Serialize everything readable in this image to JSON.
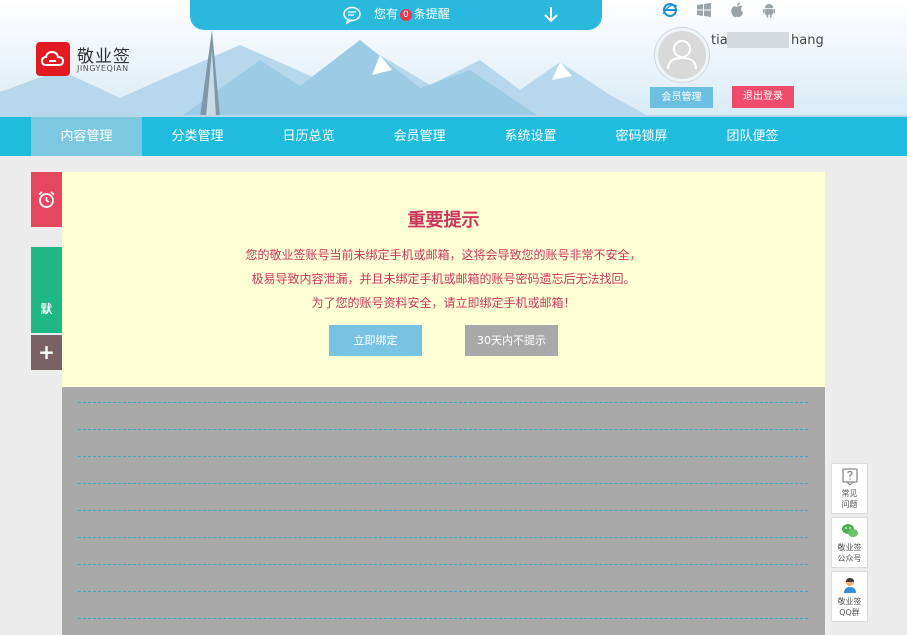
{
  "header": {
    "notice": {
      "prefix": "您有",
      "count": "0",
      "suffix": "条提醒"
    },
    "brand": {
      "name": "敬业签",
      "sub": "JINGYEQIAN"
    },
    "user": {
      "name_start": "tia",
      "name_end": "hang"
    },
    "member_button": "会员管理",
    "logout_button": "退出登录",
    "platforms": [
      "ie-icon",
      "windows-icon",
      "apple-icon",
      "android-icon"
    ]
  },
  "nav": {
    "items": [
      {
        "label": "内容管理",
        "active": true
      },
      {
        "label": "分类管理"
      },
      {
        "label": "日历总览"
      },
      {
        "label": "会员管理"
      },
      {
        "label": "系统设置"
      },
      {
        "label": "密码锁屏"
      },
      {
        "label": "团队便签"
      }
    ]
  },
  "sidebar": {
    "default_char1": "默",
    "default_char2": "认",
    "add_label": "+"
  },
  "alert": {
    "title": "重要提示",
    "lines": [
      "您的敬业签账号当前未绑定手机或邮箱，这将会导致您的账号非常不安全，",
      "极易导致内容泄漏，并且未绑定手机或邮箱的账号密码遗忘后无法找回。",
      "为了您的账号资料安全，请立即绑定手机或邮箱！"
    ],
    "bind_button": "立即绑定",
    "skip_button": "30天内不提示"
  },
  "float": {
    "faq": {
      "line1": "常见",
      "line2": "问题"
    },
    "wechat": {
      "line1": "敬业签",
      "line2": "公众号"
    },
    "qq": {
      "line1": "敬业签",
      "line2": "QQ群"
    }
  },
  "colors": {
    "nav": "#1fbcde",
    "alert_text": "#c9375c",
    "alert_bg": "#ffffd6",
    "logout": "#ef4b6b"
  }
}
